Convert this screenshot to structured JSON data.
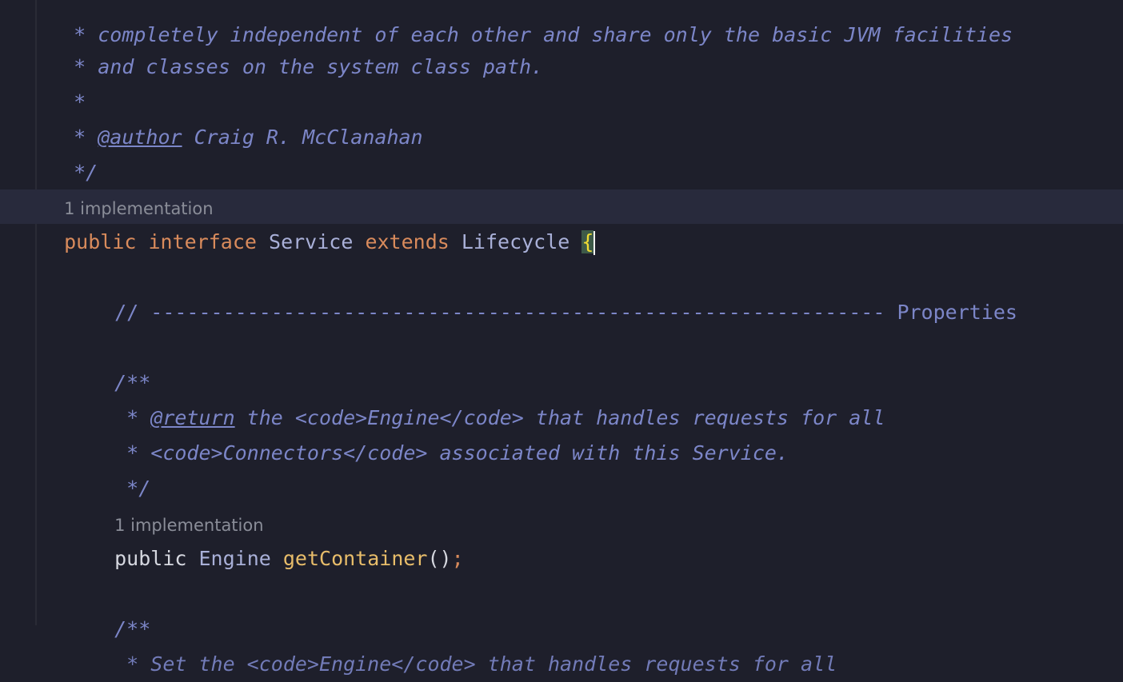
{
  "lines": {
    "l0": "* completely independent of each other and share only the basic JVM facilities",
    "l1": "* and classes on the system class path.",
    "l2": "*",
    "l3_star": "* ",
    "l3_tag": "@author",
    "l3_rest": " Craig R. McClanahan",
    "l4": "*/",
    "hint1": "1 implementation",
    "decl_public": "public",
    "decl_interface": "interface",
    "decl_name": "Service",
    "decl_extends": "extends",
    "decl_parent": "Lifecycle",
    "decl_brace": "{",
    "props": "// ------------------------------------------------------------- Properties",
    "doc_open": "/**",
    "doc1_star": " * ",
    "doc1_tag": "@return",
    "doc1_rest": " the <code>Engine</code> that handles requests for all",
    "doc2": " * <code>Connectors</code> associated with this Service.",
    "doc_close": " */",
    "hint2": "1 implementation",
    "m_public": "public",
    "m_type": "Engine",
    "m_name": "getContainer",
    "m_parens": "()",
    "m_semi": ";",
    "doc_open2": "/**",
    "doc3": " * Set the <code>Engine</code> that handles requests for all"
  }
}
